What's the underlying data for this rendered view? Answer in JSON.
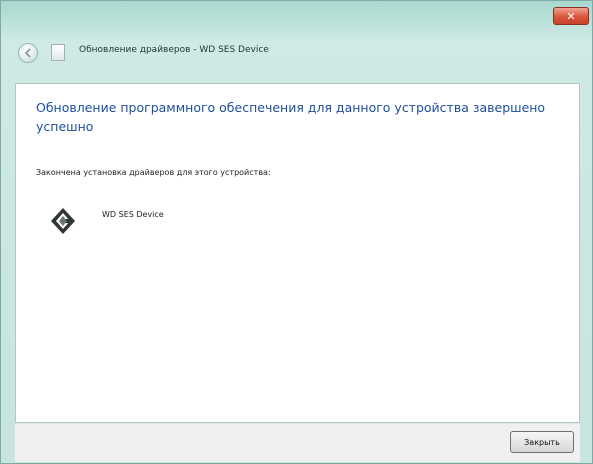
{
  "window": {
    "title": "Обновление драйверов - WD SES Device",
    "close_glyph": "✕"
  },
  "main": {
    "heading": "Обновление программного обеспечения для данного устройства завершено успешно",
    "subtext": "Закончена установка драйверов для этого устройства:",
    "device_name": "WD SES Device",
    "device_icon": "device-diamond-icon"
  },
  "footer": {
    "close_label": "Закрыть"
  },
  "colors": {
    "heading": "#1e4f9c",
    "frame": "#c7e4df",
    "close_red": "#d8553a"
  }
}
